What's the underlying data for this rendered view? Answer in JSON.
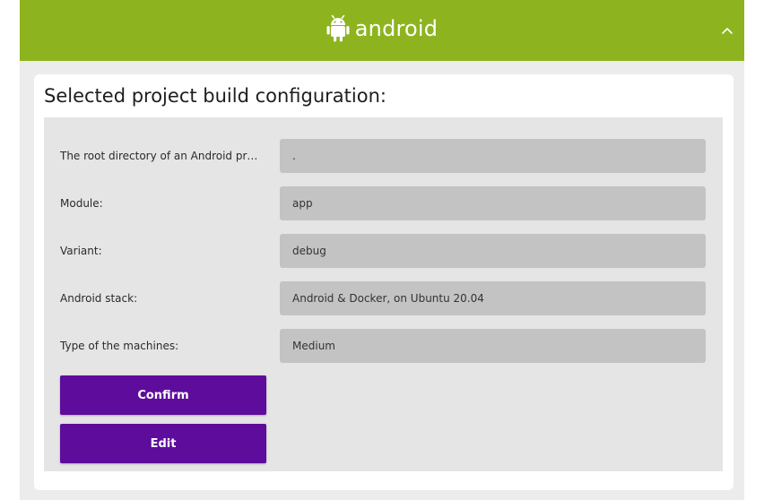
{
  "header": {
    "brand": "android",
    "icons": {
      "logo": "android-robot-icon",
      "collapse": "chevron-up-icon"
    },
    "background_color": "#8db41f"
  },
  "card": {
    "title": "Selected project build configuration:"
  },
  "config": {
    "fields": [
      {
        "label": "The root directory of an Android pr…",
        "value": "."
      },
      {
        "label": "Module:",
        "value": "app"
      },
      {
        "label": "Variant:",
        "value": "debug"
      },
      {
        "label": "Android stack:",
        "value": "Android & Docker, on Ubuntu 20.04"
      },
      {
        "label": "Type of the machines:",
        "value": "Medium"
      }
    ]
  },
  "actions": {
    "confirm_label": "Confirm",
    "edit_label": "Edit",
    "button_color": "#5e0c9c"
  }
}
